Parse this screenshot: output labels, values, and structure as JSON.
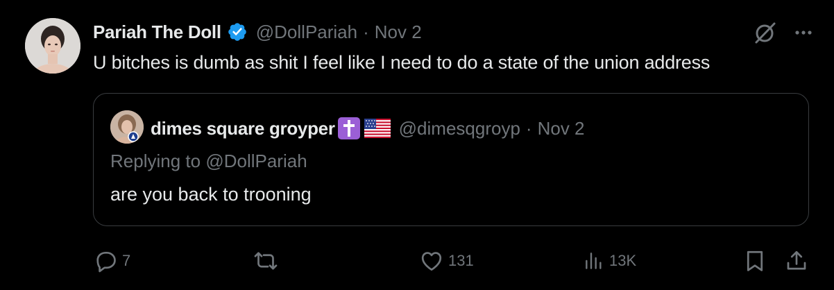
{
  "tweet": {
    "author": {
      "display_name": "Pariah The Doll",
      "handle": "@DollPariah",
      "verified": true
    },
    "separator": "·",
    "date": "Nov 2",
    "text": "U bitches is dumb as shit I feel like I need to do a state of the union address"
  },
  "quote": {
    "author": {
      "display_name": "dimes square groyper",
      "handle": "@dimesqgroyp",
      "emojis": [
        "latin-cross-emoji",
        "us-flag-emoji"
      ]
    },
    "separator": "·",
    "date": "Nov 2",
    "replying_prefix": "Replying to ",
    "replying_to": "@DollPariah",
    "text": "are you back to trooning"
  },
  "actions": {
    "replies": "7",
    "retweets": "",
    "likes": "131",
    "views": "13K"
  },
  "colors": {
    "background": "#000000",
    "text": "#e7e9ea",
    "muted": "#71767b",
    "verified": "#1d9bf0",
    "border": "#3a3d40",
    "cross_bg": "#9b5fd6"
  },
  "icons": [
    "verified-badge-icon",
    "grok-icon",
    "more-icon",
    "reply-icon",
    "retweet-icon",
    "like-icon",
    "views-icon",
    "bookmark-icon",
    "share-icon"
  ]
}
